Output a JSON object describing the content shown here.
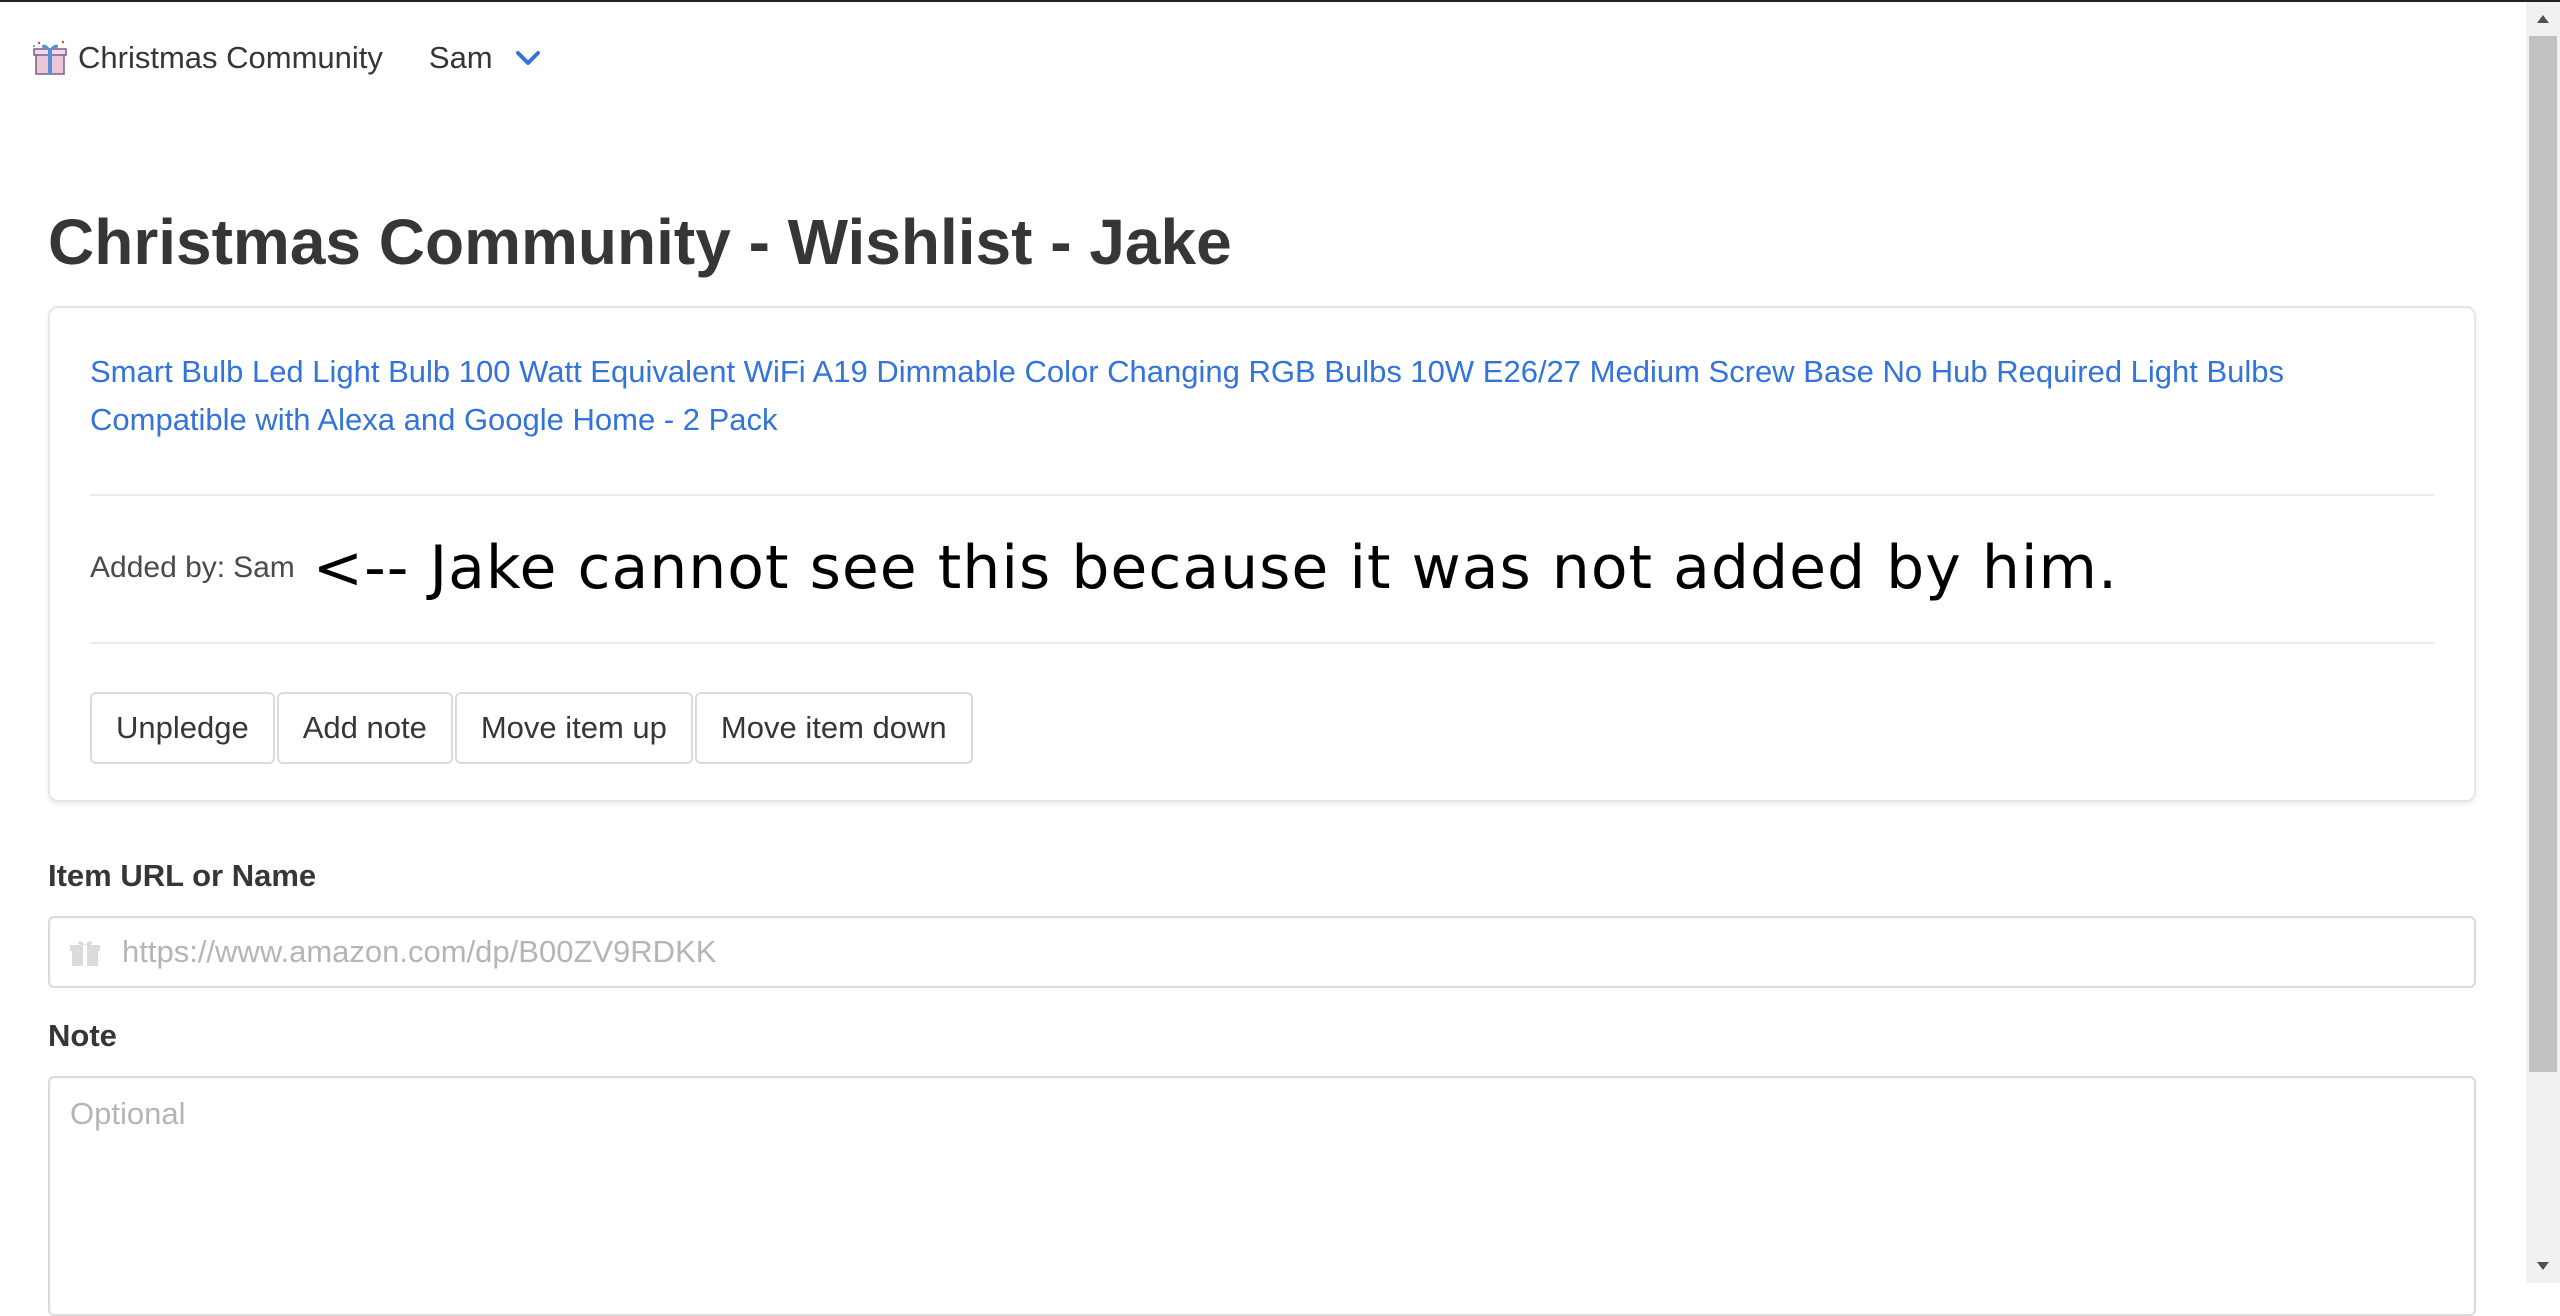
{
  "navbar": {
    "brand_icon": "gift-icon",
    "brand_text": "Christmas Community",
    "user_name": "Sam",
    "user_menu_icon": "chevron-down-icon"
  },
  "page_title": "Christmas Community - Wishlist - Jake",
  "item": {
    "link_text": "Smart Bulb Led Light Bulb 100 Watt Equivalent WiFi A19 Dimmable Color Changing RGB Bulbs 10W E26/27 Medium Screw Base No Hub Required Light Bulbs Compatible with Alexa and Google Home - 2 Pack",
    "added_by_label": "Added by:",
    "added_by_name": "Sam",
    "annotation": "<-- Jake cannot see this because it was not added by him.",
    "buttons": {
      "unpledge": "Unpledge",
      "add_note": "Add note",
      "move_up": "Move item up",
      "move_down": "Move item down"
    }
  },
  "form": {
    "url_label": "Item URL or Name",
    "url_placeholder": "https://www.amazon.com/dp/B00ZV9RDKK",
    "url_icon": "gift-icon",
    "note_label": "Note",
    "note_placeholder": "Optional"
  },
  "colors": {
    "link": "#3273dc",
    "text": "#363636",
    "border": "#dbdbdb",
    "placeholder": "#b5b5b5"
  }
}
